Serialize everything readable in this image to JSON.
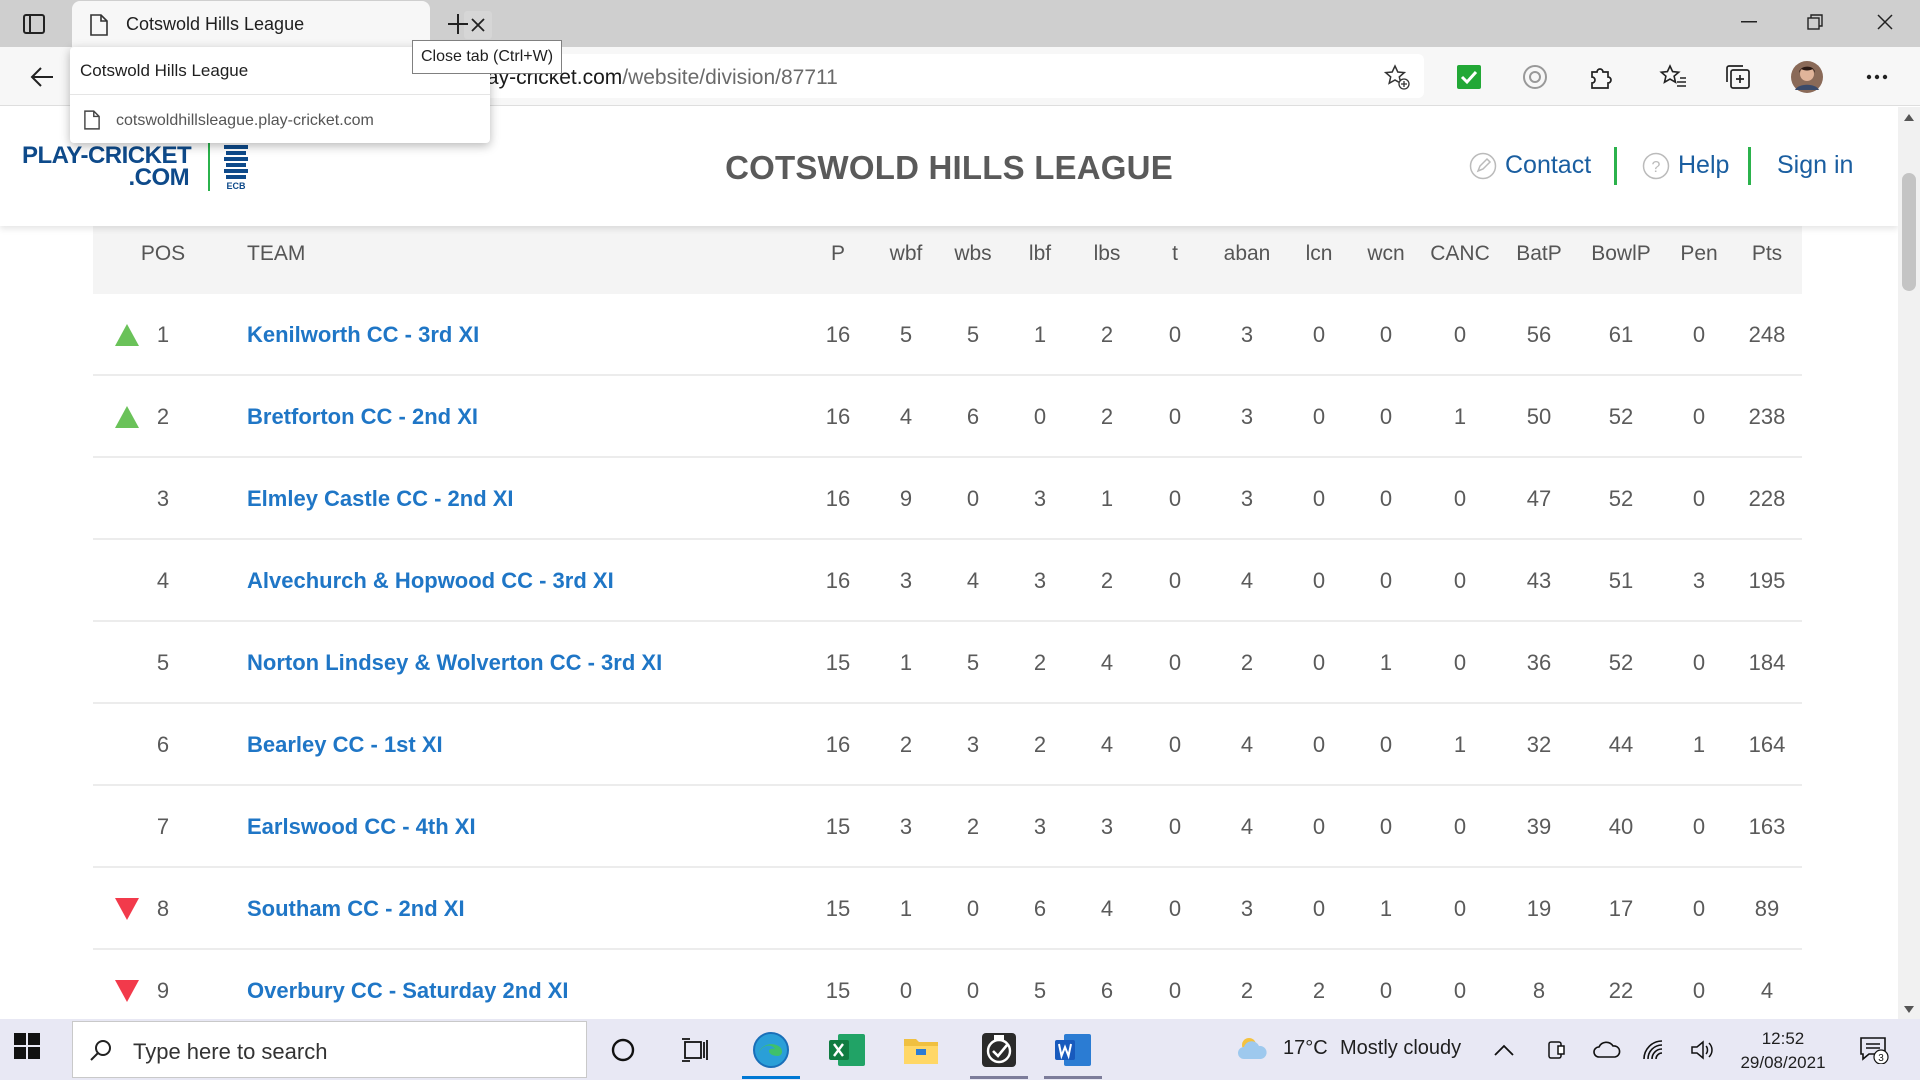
{
  "browser": {
    "tab_title": "Cotswold Hills League",
    "close_tab_tooltip": "Close tab (Ctrl+W)",
    "tab_popup": {
      "title": "Cotswold Hills League",
      "url": "cotswoldhillsleague.play-cricket.com"
    },
    "address": {
      "host": "ague.play-cricket.com",
      "path": "/website/division/87711"
    }
  },
  "site": {
    "logo_line1": "PLAY-CRICKET",
    "logo_line2": ".COM",
    "ecb_label": "ECB",
    "title": "COTSWOLD HILLS LEAGUE",
    "nav": {
      "contact": "Contact",
      "help": "Help",
      "sign_in": "Sign in"
    }
  },
  "table": {
    "headers": [
      "POS",
      "TEAM",
      "P",
      "wbf",
      "wbs",
      "lbf",
      "lbs",
      "t",
      "aban",
      "lcn",
      "wcn",
      "CANC",
      "BatP",
      "BowlP",
      "Pen",
      "Pts"
    ],
    "rows": [
      {
        "mover": "up",
        "pos": "1",
        "team": "Kenilworth CC - 3rd XI",
        "stats": [
          "16",
          "5",
          "5",
          "1",
          "2",
          "0",
          "3",
          "0",
          "0",
          "0",
          "56",
          "61",
          "0",
          "248"
        ]
      },
      {
        "mover": "up",
        "pos": "2",
        "team": "Bretforton CC - 2nd XI",
        "stats": [
          "16",
          "4",
          "6",
          "0",
          "2",
          "0",
          "3",
          "0",
          "0",
          "1",
          "50",
          "52",
          "0",
          "238"
        ]
      },
      {
        "mover": "",
        "pos": "3",
        "team": "Elmley Castle CC - 2nd XI",
        "stats": [
          "16",
          "9",
          "0",
          "3",
          "1",
          "0",
          "3",
          "0",
          "0",
          "0",
          "47",
          "52",
          "0",
          "228"
        ]
      },
      {
        "mover": "",
        "pos": "4",
        "team": "Alvechurch & Hopwood CC - 3rd XI",
        "stats": [
          "16",
          "3",
          "4",
          "3",
          "2",
          "0",
          "4",
          "0",
          "0",
          "0",
          "43",
          "51",
          "3",
          "195"
        ]
      },
      {
        "mover": "",
        "pos": "5",
        "team": "Norton Lindsey & Wolverton CC - 3rd XI",
        "stats": [
          "15",
          "1",
          "5",
          "2",
          "4",
          "0",
          "2",
          "0",
          "1",
          "0",
          "36",
          "52",
          "0",
          "184"
        ]
      },
      {
        "mover": "",
        "pos": "6",
        "team": "Bearley CC - 1st XI",
        "stats": [
          "16",
          "2",
          "3",
          "2",
          "4",
          "0",
          "4",
          "0",
          "0",
          "1",
          "32",
          "44",
          "1",
          "164"
        ]
      },
      {
        "mover": "",
        "pos": "7",
        "team": "Earlswood CC - 4th XI",
        "stats": [
          "15",
          "3",
          "2",
          "3",
          "3",
          "0",
          "4",
          "0",
          "0",
          "0",
          "39",
          "40",
          "0",
          "163"
        ]
      },
      {
        "mover": "down",
        "pos": "8",
        "team": "Southam CC - 2nd XI",
        "stats": [
          "15",
          "1",
          "0",
          "6",
          "4",
          "0",
          "3",
          "0",
          "1",
          "0",
          "19",
          "17",
          "0",
          "89"
        ]
      },
      {
        "mover": "down",
        "pos": "9",
        "team": "Overbury CC - Saturday 2nd XI",
        "stats": [
          "15",
          "0",
          "0",
          "5",
          "6",
          "0",
          "2",
          "2",
          "0",
          "0",
          "8",
          "22",
          "0",
          "4"
        ]
      }
    ]
  },
  "taskbar": {
    "search_placeholder": "Type here to search",
    "weather_temp": "17°C",
    "weather_desc": "Mostly cloudy",
    "time": "12:52",
    "date": "29/08/2021",
    "notification_count": "3"
  }
}
